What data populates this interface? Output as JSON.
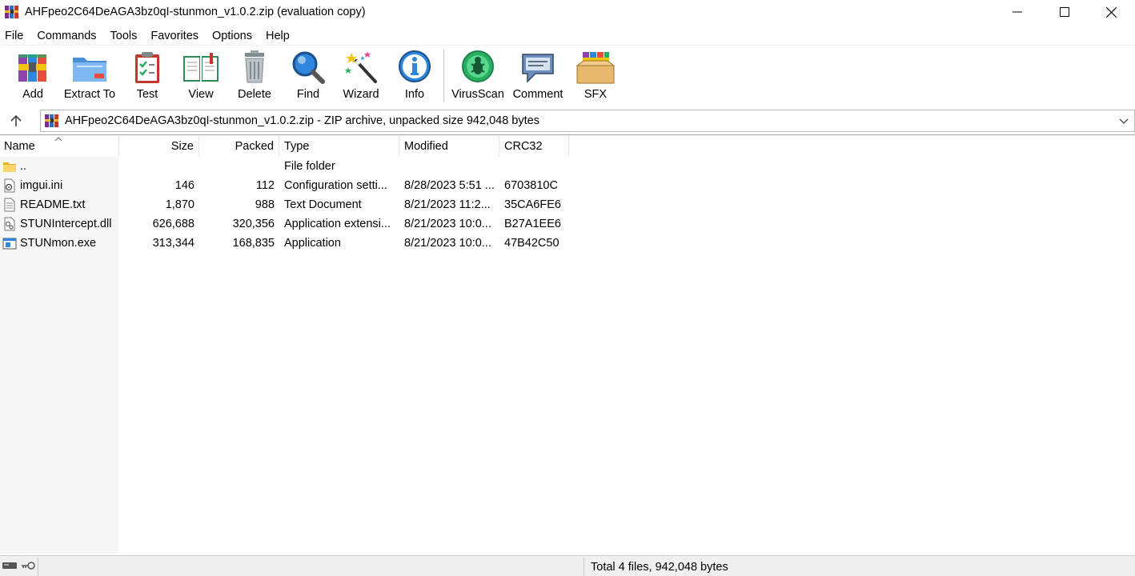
{
  "window": {
    "title": "AHFpeo2C64DeAGA3bz0qI-stunmon_v1.0.2.zip (evaluation copy)",
    "controls": [
      "minimize",
      "maximize",
      "close"
    ]
  },
  "menu": [
    "File",
    "Commands",
    "Tools",
    "Favorites",
    "Options",
    "Help"
  ],
  "toolbar": [
    {
      "label": "Add",
      "icon": "add-archive-icon"
    },
    {
      "label": "Extract To",
      "icon": "extract-folder-icon"
    },
    {
      "label": "Test",
      "icon": "test-clipboard-icon"
    },
    {
      "label": "View",
      "icon": "view-book-icon"
    },
    {
      "label": "Delete",
      "icon": "trash-icon"
    },
    {
      "label": "Find",
      "icon": "magnifier-icon"
    },
    {
      "label": "Wizard",
      "icon": "magic-wand-icon"
    },
    {
      "label": "Info",
      "icon": "info-icon"
    },
    {
      "label": "VirusScan",
      "icon": "virus-scan-icon"
    },
    {
      "label": "Comment",
      "icon": "comment-icon"
    },
    {
      "label": "SFX",
      "icon": "sfx-box-icon"
    }
  ],
  "address": {
    "text": "AHFpeo2C64DeAGA3bz0qI-stunmon_v1.0.2.zip - ZIP archive, unpacked size 942,048 bytes"
  },
  "columns": {
    "name": "Name",
    "size": "Size",
    "packed": "Packed",
    "type": "Type",
    "modified": "Modified",
    "crc": "CRC32"
  },
  "files": [
    {
      "name": "..",
      "size": "",
      "packed": "",
      "type": "File folder",
      "modified": "",
      "crc": "",
      "icon": "folder-icon"
    },
    {
      "name": "imgui.ini",
      "size": "146",
      "packed": "112",
      "type": "Configuration setti...",
      "modified": "8/28/2023 5:51 ...",
      "crc": "6703810C",
      "icon": "config-file-icon"
    },
    {
      "name": "README.txt",
      "size": "1,870",
      "packed": "988",
      "type": "Text Document",
      "modified": "8/21/2023 11:2...",
      "crc": "35CA6FE6",
      "icon": "text-file-icon"
    },
    {
      "name": "STUNIntercept.dll",
      "size": "626,688",
      "packed": "320,356",
      "type": "Application extensi...",
      "modified": "8/21/2023 10:0...",
      "crc": "B27A1EE6",
      "icon": "dll-file-icon"
    },
    {
      "name": "STUNmon.exe",
      "size": "313,344",
      "packed": "168,835",
      "type": "Application",
      "modified": "8/21/2023 10:0...",
      "crc": "47B42C50",
      "icon": "exe-file-icon"
    }
  ],
  "status": {
    "summary": "Total 4 files, 942,048 bytes"
  }
}
